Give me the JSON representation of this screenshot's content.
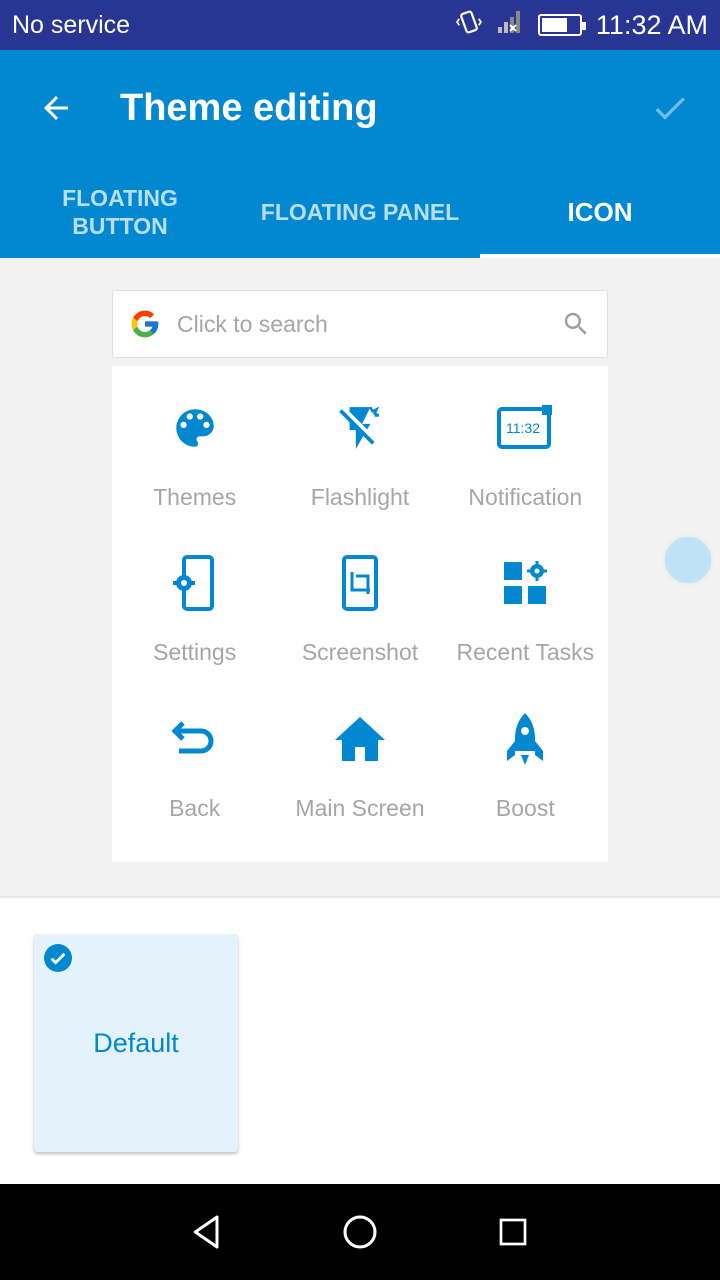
{
  "status_bar": {
    "carrier": "No service",
    "time": "11:32 AM",
    "battery_level": 0.7
  },
  "app_bar": {
    "title": "Theme editing",
    "back_icon": "arrow-back-icon",
    "confirm_icon": "check-icon"
  },
  "tabs": [
    {
      "label": "FLOATING\nBUTTON",
      "active": false
    },
    {
      "label": "FLOATING PANEL",
      "active": false
    },
    {
      "label": "ICON",
      "active": true
    }
  ],
  "search": {
    "placeholder": "Click to search",
    "icon": "search-icon",
    "brand_icon": "google-logo-icon"
  },
  "panel_items": [
    {
      "label": "Themes",
      "icon": "palette-icon"
    },
    {
      "label": "Flashlight",
      "icon": "flashlight-off-icon"
    },
    {
      "label": "Notification",
      "icon": "notification-clock-icon",
      "icon_text": "11:32"
    },
    {
      "label": "Settings",
      "icon": "phone-settings-icon"
    },
    {
      "label": "Screenshot",
      "icon": "screenshot-crop-icon"
    },
    {
      "label": "Recent Tasks",
      "icon": "recent-tasks-icon"
    },
    {
      "label": "Back",
      "icon": "back-arrow-icon"
    },
    {
      "label": "Main Screen",
      "icon": "home-icon"
    },
    {
      "label": "Boost",
      "icon": "rocket-icon"
    }
  ],
  "themes": [
    {
      "label": "Default",
      "selected": true
    }
  ],
  "colors": {
    "primary": "#0288d1",
    "status_bar": "#283593",
    "icon_blue": "#0288d1",
    "label_gray": "#a6a6a6"
  }
}
